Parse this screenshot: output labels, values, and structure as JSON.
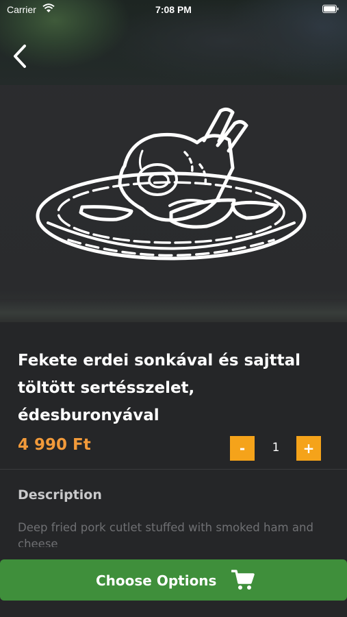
{
  "status_bar": {
    "carrier": "Carrier",
    "time": "7:08 PM"
  },
  "icons": {
    "back": "chevron-left-icon",
    "wifi": "wifi-icon",
    "battery": "battery-icon",
    "cart": "shopping-cart-icon",
    "dish": "pork-knuckle-plate-illustration"
  },
  "product": {
    "title_lines": [
      "Fekete erdei sonkával és sajttal",
      "töltött sertésszelet,",
      "édesburonyával"
    ],
    "price": "4 990 Ft",
    "quantity": "1",
    "minus_label": "-",
    "plus_label": "+"
  },
  "description": {
    "heading": "Description",
    "text": "Deep fried pork cutlet stuffed with smoked ham and cheese"
  },
  "cta": {
    "label": "Choose Options"
  },
  "colors": {
    "background": "#252628",
    "price": "#f29a3a",
    "stepper": "#f5a31a",
    "cta": "#3f8f3b"
  }
}
